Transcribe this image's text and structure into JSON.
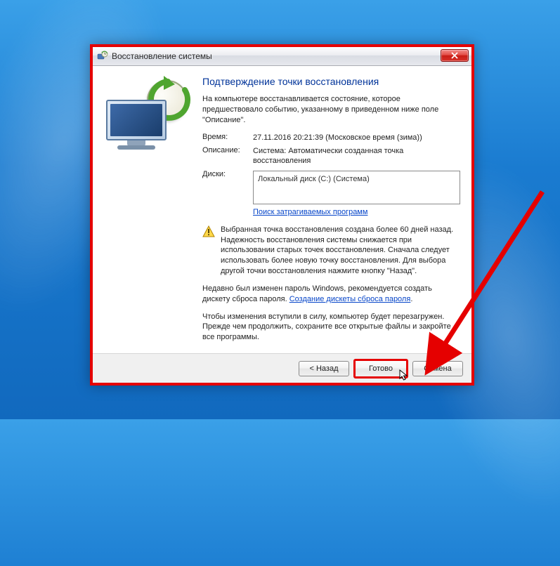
{
  "window": {
    "title": "Восстановление системы"
  },
  "heading": "Подтверждение точки восстановления",
  "intro": "На компьютере восстанавливается состояние, которое предшествовало событию, указанному в приведенном ниже поле \"Описание\".",
  "fields": {
    "time_label": "Время:",
    "time_value": "27.11.2016 20:21:39 (Московское время (зима))",
    "desc_label": "Описание:",
    "desc_value": "Система: Автоматически созданная точка восстановления",
    "disks_label": "Диски:",
    "disks_value": "Локальный диск (C:) (Система)"
  },
  "scan_link": "Поиск затрагиваемых программ",
  "warning_text": "Выбранная точка восстановления создана более 60 дней назад. Надежность восстановления системы снижается при использовании старых точек восстановления. Сначала следует использовать более новую точку восстановления. Для выбора другой точки восстановления нажмите кнопку \"Назад\".",
  "password_text_before": "Недавно был изменен пароль Windows, рекомендуется создать дискету сброса пароля. ",
  "password_link": "Создание дискеты сброса пароля",
  "reboot_text": "Чтобы изменения вступили в силу, компьютер будет перезагружен. Прежде чем продолжить, сохраните все открытые файлы и закройте все программы.",
  "buttons": {
    "back": "< Назад",
    "finish": "Готово",
    "cancel": "Отмена"
  }
}
